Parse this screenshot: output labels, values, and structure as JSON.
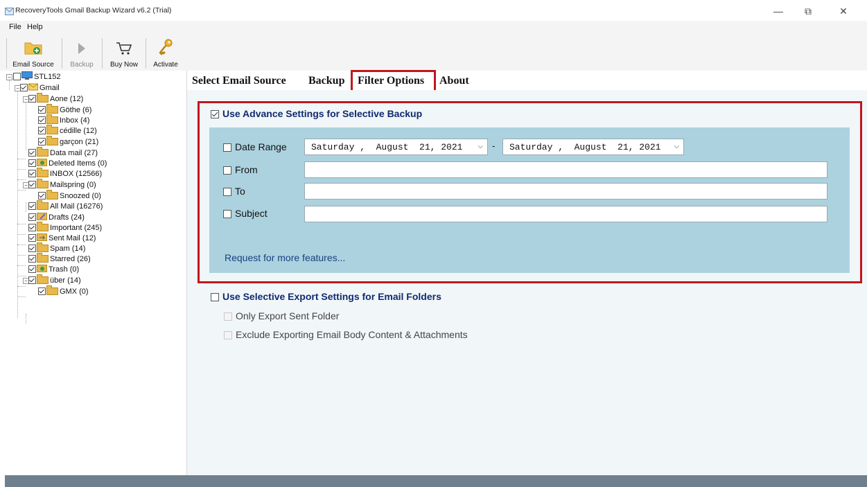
{
  "window": {
    "title": "RecoveryTools Gmail Backup Wizard v6.2 (Trial)",
    "minimize": "—",
    "maximize": "⧉",
    "close": "✕"
  },
  "menu": [
    "File",
    "Help"
  ],
  "toolbar": {
    "email_source": "Email Source",
    "backup": "Backup",
    "buy_now": "Buy Now",
    "activate": "Activate"
  },
  "tree": {
    "root": "STL152",
    "account": "Gmail",
    "folders": [
      {
        "label": "Aone (12)"
      },
      {
        "label": "Göthe (6)"
      },
      {
        "label": "Inbox (4)"
      },
      {
        "label": "cédille (12)"
      },
      {
        "label": "garçon (21)"
      },
      {
        "label": "Data mail (27)"
      },
      {
        "label": "Deleted Items (0)"
      },
      {
        "label": "INBOX (12566)"
      },
      {
        "label": "Mailspring (0)"
      },
      {
        "label": "Snoozed (0)"
      },
      {
        "label": "All Mail (16276)"
      },
      {
        "label": "Drafts (24)"
      },
      {
        "label": "Important (245)"
      },
      {
        "label": "Sent Mail (12)"
      },
      {
        "label": "Spam (14)"
      },
      {
        "label": "Starred (26)"
      },
      {
        "label": "Trash (0)"
      },
      {
        "label": "über (14)"
      },
      {
        "label": "GMX (0)"
      }
    ]
  },
  "tabs": [
    "Select Email Source",
    "Backup",
    "Filter Options",
    "About"
  ],
  "filter": {
    "advance_settings_label": "Use Advance Settings for Selective Backup",
    "date_range_label": "Date Range",
    "date_from": "Saturday ,  August  21, 2021",
    "date_separator": "-",
    "date_to": "Saturday ,  August  21, 2021",
    "from_label": "From",
    "to_label": "To",
    "subject_label": "Subject",
    "request_link": "Request for more features..."
  },
  "export_settings": {
    "label": "Use Selective Export Settings for Email Folders",
    "option_sent": "Only Export Sent Folder",
    "option_exclude": "Exclude Exporting Email Body Content & Attachments"
  },
  "colors": {
    "highlight_red": "#c2161d",
    "panel_blue": "#acd2df",
    "heading_blue": "#102a6e",
    "link_blue": "#17407f"
  }
}
